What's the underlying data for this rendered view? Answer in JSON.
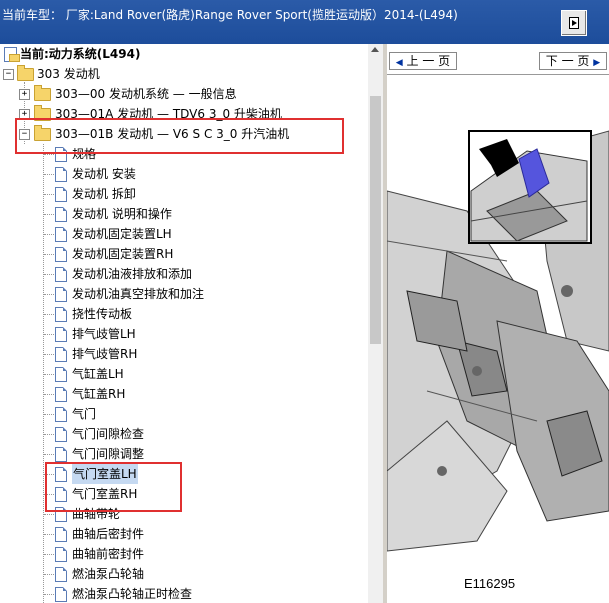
{
  "title_bar": {
    "text": "当前车型：  厂家:Land Rover(路虎)Range Rover Sport(揽胜运动版）2014-(L494)"
  },
  "tree": {
    "root": "当前:动力系统(L494)",
    "engine": "303 发动机",
    "items": [
      "303—00 发动机系统 — 一般信息",
      "303—01A 发动机 — TDV6 3_0 升柴油机",
      "303—01B 发动机 — V6 S C 3_0 升汽油机"
    ],
    "docs": [
      "规格",
      "发动机 安装",
      "发动机 拆卸",
      "发动机 说明和操作",
      "发动机固定装置LH",
      "发动机固定装置RH",
      "发动机油液排放和添加",
      "发动机油真空排放和加注",
      "挠性传动板",
      "排气歧管LH",
      "排气歧管RH",
      "气缸盖LH",
      "气缸盖RH",
      "气门",
      "气门间隙检查",
      "气门间隙调整",
      "气门室盖LH",
      "气门室盖RH",
      "曲轴带轮",
      "曲轴后密封件",
      "曲轴前密封件",
      "燃油泵凸轮轴",
      "燃油泵凸轮轴正时检查"
    ],
    "selected_index": 16
  },
  "viewer": {
    "prev_label": "上 一 页",
    "next_label": "下 一 页",
    "figure_caption": "E116295"
  }
}
